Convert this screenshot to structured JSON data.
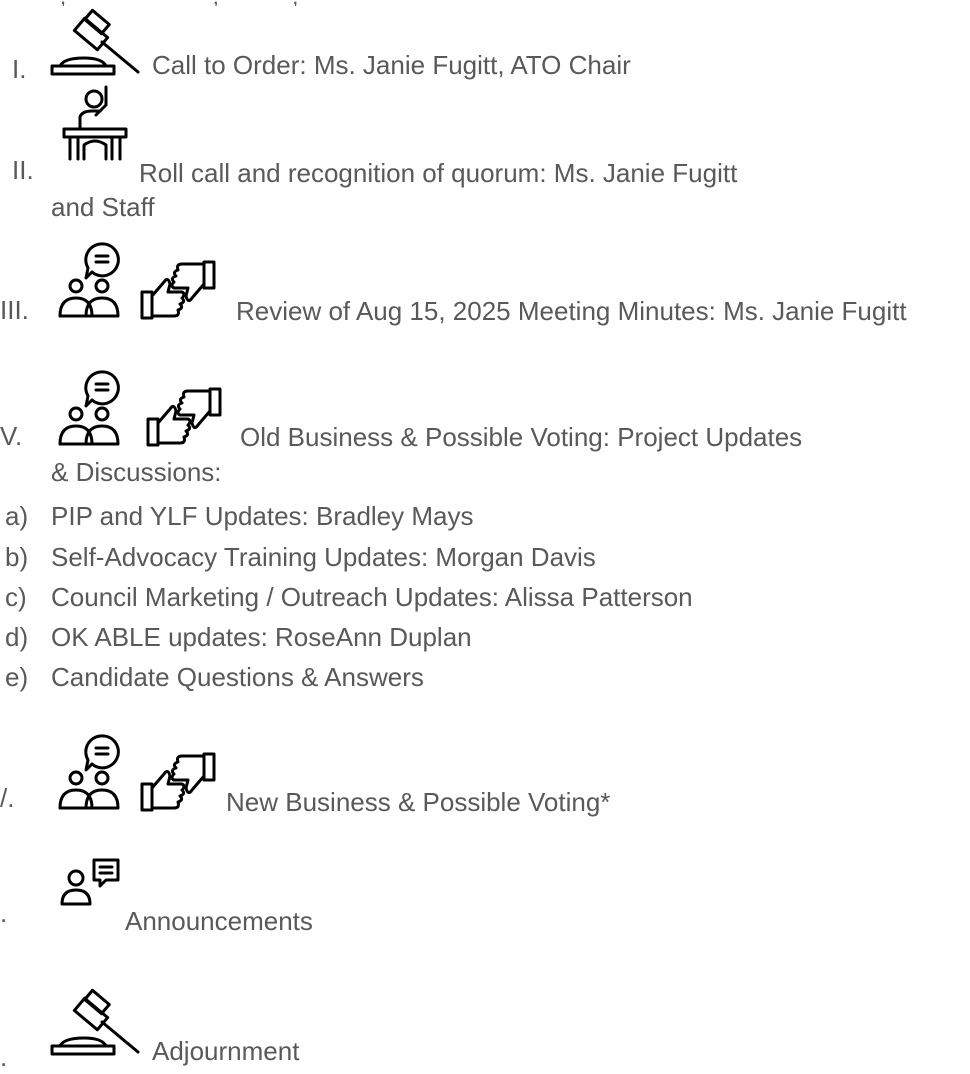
{
  "agenda": {
    "items": [
      {
        "numeral": "I.",
        "text": "Call to Order: Ms. Janie Fugitt, ATO Chair",
        "icon": "gavel-icon"
      },
      {
        "numeral": "II.",
        "text": "Roll call and recognition of quorum: Ms. Janie Fugitt",
        "text2": "and Staff",
        "icon": "raised-hand-podium-icon"
      },
      {
        "numeral": "III.",
        "text": "Review of Aug 15, 2025 Meeting Minutes: Ms. Janie Fugitt",
        "icons": [
          "discussion-group-icon",
          "thumbs-up-down-icon"
        ]
      },
      {
        "numeral": "V.",
        "text": "Old Business & Possible Voting: Project Updates",
        "text2": "& Discussions:",
        "icons": [
          "discussion-group-icon",
          "thumbs-up-down-icon"
        ],
        "subitems": [
          {
            "letter": "a)",
            "text": "PIP and YLF Updates: Bradley Mays"
          },
          {
            "letter": "b)",
            "text": "Self-Advocacy Training Updates: Morgan Davis"
          },
          {
            "letter": "c)",
            "text": "Council Marketing / Outreach Updates: Alissa Patterson"
          },
          {
            "letter": "d)",
            "text": "OK ABLE updates: RoseAnn Duplan"
          },
          {
            "letter": "e)",
            "text": "Candidate Questions & Answers"
          }
        ]
      },
      {
        "numeral": "/.",
        "text": "New Business & Possible Voting*",
        "icons": [
          "discussion-group-icon",
          "thumbs-up-down-icon"
        ]
      },
      {
        "numeral": ".",
        "text": "Announcements",
        "icon": "person-speech-icon"
      },
      {
        "numeral": ".",
        "text": "Adjournment",
        "icon": "gavel-icon"
      }
    ]
  },
  "colors": {
    "text": "#595959",
    "icon": "#000000",
    "background": "#ffffff"
  }
}
